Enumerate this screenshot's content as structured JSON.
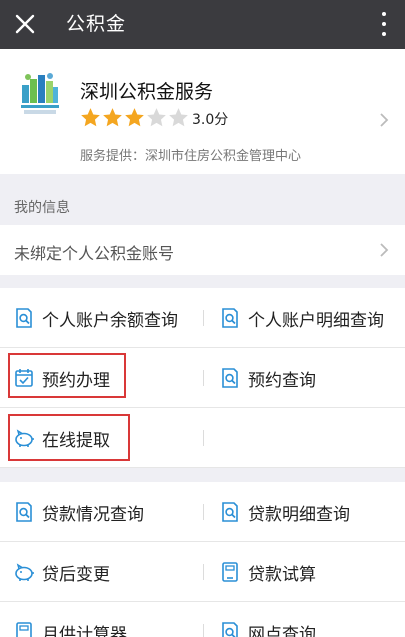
{
  "header": {
    "title": "公积金"
  },
  "service": {
    "name": "深圳公积金服务",
    "rating": 3,
    "rating_max": 5,
    "score": "3.0分",
    "provider": "服务提供：深圳市住房公积金管理中心"
  },
  "section_label": "我的信息",
  "account_row": {
    "text": "未绑定个人公积金账号"
  },
  "group1": [
    {
      "left": {
        "label": "个人账户余额查询",
        "icon": "search-doc-icon"
      },
      "right": {
        "label": "个人账户明细查询",
        "icon": "search-doc-icon"
      }
    },
    {
      "left": {
        "label": "预约办理",
        "icon": "calendar-check-icon"
      },
      "right": {
        "label": "预约查询",
        "icon": "search-doc-icon"
      }
    },
    {
      "left": {
        "label": "在线提取",
        "icon": "piggy-bank-icon"
      },
      "right": {
        "label": ""
      }
    }
  ],
  "group2": [
    {
      "left": {
        "label": "贷款情况查询",
        "icon": "search-doc-icon"
      },
      "right": {
        "label": "贷款明细查询",
        "icon": "search-doc-icon"
      }
    },
    {
      "left": {
        "label": "贷后变更",
        "icon": "piggy-bank-icon"
      },
      "right": {
        "label": "贷款试算",
        "icon": "calculator-icon"
      }
    },
    {
      "left": {
        "label": "月供计算器",
        "icon": "calculator-icon"
      },
      "right": {
        "label": "网点查询",
        "icon": "search-doc-icon"
      }
    }
  ],
  "colors": {
    "accent": "#2a8fd6",
    "star": "#f4a620",
    "highlight": "#d93838",
    "topbar": "#3b3b3f"
  }
}
